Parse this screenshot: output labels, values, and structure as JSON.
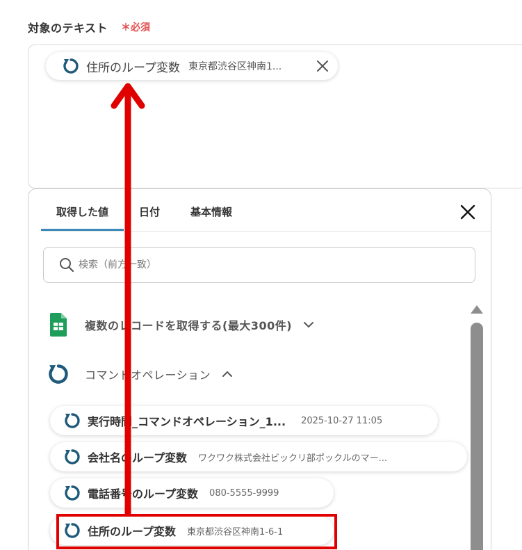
{
  "field": {
    "label": "対象のテキスト",
    "required": "＊必須"
  },
  "selected_chip": {
    "name": "住所のループ変数",
    "value": "東京都渋谷区神南1..."
  },
  "panel": {
    "tabs": [
      {
        "label": "取得した値",
        "active": true
      },
      {
        "label": "日付",
        "active": false
      },
      {
        "label": "基本情報",
        "active": false
      }
    ],
    "search_placeholder": "検索（前方一致）",
    "groups": [
      {
        "title": "複数のレコードを取得する(最大300件)",
        "icon": "google-sheets-icon",
        "expanded": false
      },
      {
        "title": "コマンドオペレーション",
        "icon": "loop-icon",
        "expanded": true
      }
    ],
    "items": [
      {
        "name": "実行時間_コマンドオペレーション_1...",
        "value": "2025-10-27 11:05"
      },
      {
        "name": "会社名のループ変数",
        "value": "ワクワク株式会社ビックリ部ポックルのマー..."
      },
      {
        "name": "電話番号のループ変数",
        "value": "080-5555-9999"
      },
      {
        "name": "住所のループ変数",
        "value": "東京都渋谷区神南1-6-1"
      }
    ]
  },
  "colors": {
    "accent": "#3b89b8",
    "loop_icon": "#1f5a7a",
    "annotation": "#e00000",
    "required": "#e05050",
    "sheets": "#1e9e5a"
  }
}
